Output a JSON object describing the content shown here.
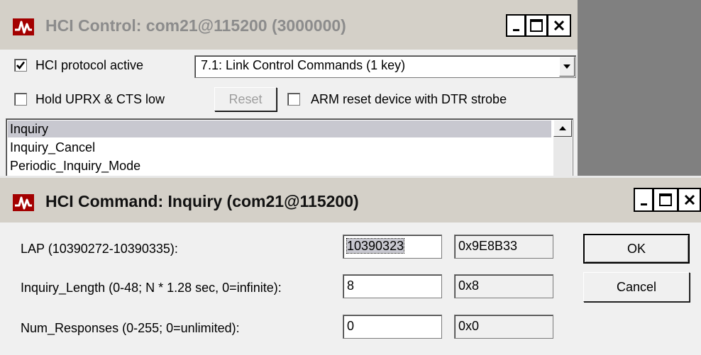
{
  "control_window": {
    "title": "HCI Control: com21@115200 (3000000)",
    "protocol_checkbox": {
      "label": "HCI protocol active",
      "checked": true
    },
    "command_group": {
      "selected": "7.1: Link Control Commands (1 key)"
    },
    "hold_checkbox": {
      "label": "Hold UPRX & CTS low",
      "checked": false
    },
    "reset_button": "Reset",
    "arm_checkbox": {
      "label": "ARM reset device with DTR strobe",
      "checked": false
    },
    "commands": [
      "Inquiry",
      "Inquiry_Cancel",
      "Periodic_Inquiry_Mode"
    ]
  },
  "command_window": {
    "title": "HCI Command: Inquiry (com21@115200)",
    "params": [
      {
        "label": "LAP (10390272-10390335):",
        "value": "10390323",
        "hex": "0x9E8B33"
      },
      {
        "label": "Inquiry_Length (0-48; N * 1.28 sec, 0=infinite):",
        "value": "8",
        "hex": "0x8"
      },
      {
        "label": "Num_Responses (0-255; 0=unlimited):",
        "value": "0",
        "hex": "0x0"
      }
    ],
    "ok_button": "OK",
    "cancel_button": "Cancel"
  },
  "colors": {
    "title_icon": "#a30000",
    "window_bg": "#f0f0f0",
    "desktop": "#808080",
    "selection": "#c8c8d0"
  }
}
